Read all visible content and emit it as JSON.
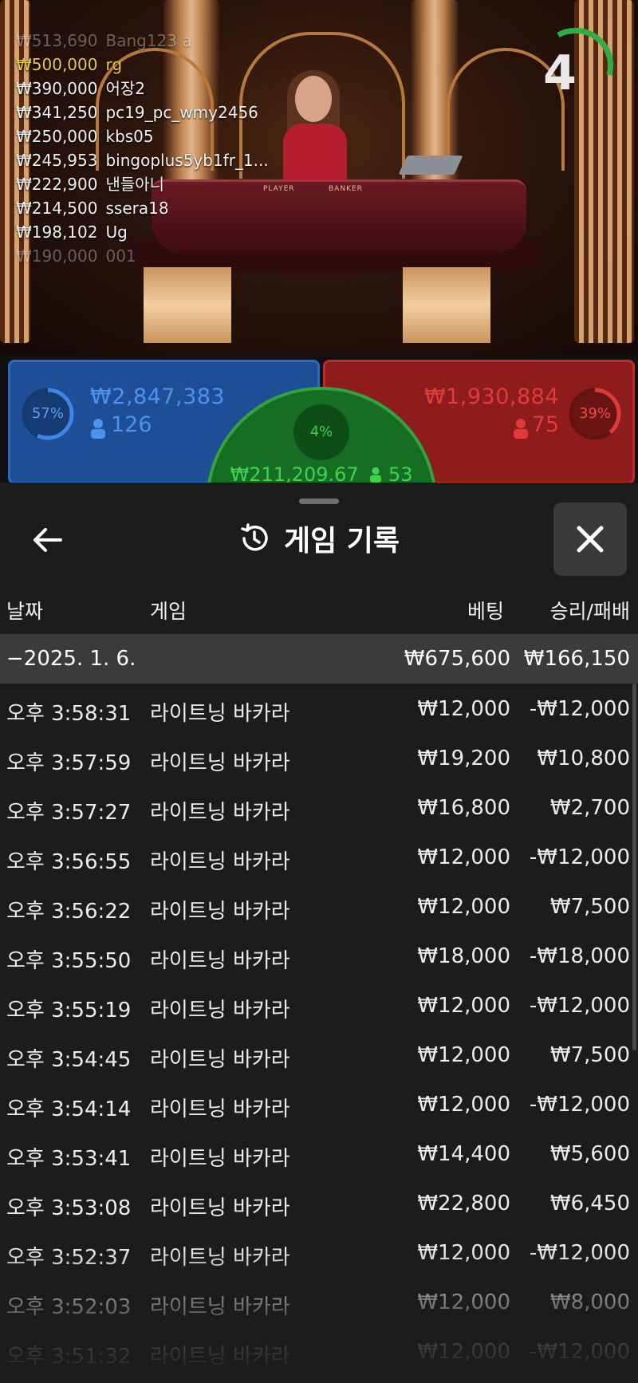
{
  "video": {
    "countdown": "4",
    "leaderboard": [
      {
        "amount": "₩513,690",
        "name": "Bang123 a",
        "style": "fade"
      },
      {
        "amount": "₩500,000",
        "name": "rg",
        "style": "gold"
      },
      {
        "amount": "₩390,000",
        "name": "어장2",
        "style": ""
      },
      {
        "amount": "₩341,250",
        "name": "pc19_pc_wmy2456",
        "style": ""
      },
      {
        "amount": "₩250,000",
        "name": "kbs05",
        "style": ""
      },
      {
        "amount": "₩245,953",
        "name": "bingoplus5yb1fr_1...",
        "style": ""
      },
      {
        "amount": "₩222,900",
        "name": "낸들아니",
        "style": ""
      },
      {
        "amount": "₩214,500",
        "name": "ssera18",
        "style": ""
      },
      {
        "amount": "₩198,102",
        "name": "Ug",
        "style": ""
      },
      {
        "amount": "₩190,000",
        "name": "001",
        "style": "fade"
      }
    ],
    "table_labels": {
      "player": "PLAYER",
      "banker": "BANKER"
    }
  },
  "bets": {
    "player": {
      "percent": "57%",
      "percent_value": 0.57,
      "amount": "₩2,847,383",
      "count": "126",
      "color": "#2c68c2"
    },
    "banker": {
      "percent": "39%",
      "percent_value": 0.39,
      "amount": "₩1,930,884",
      "count": "75",
      "color": "#c22a2a"
    },
    "tie": {
      "percent": "4%",
      "percent_value": 0.04,
      "amount": "₩211,209.67",
      "count": "53",
      "color": "#32a33e"
    }
  },
  "history": {
    "title": "게임 기록",
    "columns": {
      "date": "날짜",
      "game": "게임",
      "bet": "베팅",
      "result": "승리/패배"
    },
    "day": {
      "label": "−2025. 1. 6.",
      "bet": "₩675,600",
      "result": "₩166,150"
    },
    "rows": [
      {
        "time": "오후 3:58:31",
        "game": "라이트닝 바카라",
        "bet": "₩12,000",
        "result": "-₩12,000"
      },
      {
        "time": "오후 3:57:59",
        "game": "라이트닝 바카라",
        "bet": "₩19,200",
        "result": "₩10,800"
      },
      {
        "time": "오후 3:57:27",
        "game": "라이트닝 바카라",
        "bet": "₩16,800",
        "result": "₩2,700"
      },
      {
        "time": "오후 3:56:55",
        "game": "라이트닝 바카라",
        "bet": "₩12,000",
        "result": "-₩12,000"
      },
      {
        "time": "오후 3:56:22",
        "game": "라이트닝 바카라",
        "bet": "₩12,000",
        "result": "₩7,500"
      },
      {
        "time": "오후 3:55:50",
        "game": "라이트닝 바카라",
        "bet": "₩18,000",
        "result": "-₩18,000"
      },
      {
        "time": "오후 3:55:19",
        "game": "라이트닝 바카라",
        "bet": "₩12,000",
        "result": "-₩12,000"
      },
      {
        "time": "오후 3:54:45",
        "game": "라이트닝 바카라",
        "bet": "₩12,000",
        "result": "₩7,500"
      },
      {
        "time": "오후 3:54:14",
        "game": "라이트닝 바카라",
        "bet": "₩12,000",
        "result": "-₩12,000"
      },
      {
        "time": "오후 3:53:41",
        "game": "라이트닝 바카라",
        "bet": "₩14,400",
        "result": "₩5,600"
      },
      {
        "time": "오후 3:53:08",
        "game": "라이트닝 바카라",
        "bet": "₩22,800",
        "result": "₩6,450"
      },
      {
        "time": "오후 3:52:37",
        "game": "라이트닝 바카라",
        "bet": "₩12,000",
        "result": "-₩12,000"
      },
      {
        "time": "오후 3:52:03",
        "game": "라이트닝 바카라",
        "bet": "₩12,000",
        "result": "₩8,000"
      },
      {
        "time": "오후 3:51:32",
        "game": "라이트닝 바카라",
        "bet": "₩12,000",
        "result": "-₩12,000"
      }
    ]
  },
  "icons": {
    "back": "arrow-left-icon",
    "history": "history-clock-icon",
    "close": "close-icon",
    "person": "person-icon"
  }
}
